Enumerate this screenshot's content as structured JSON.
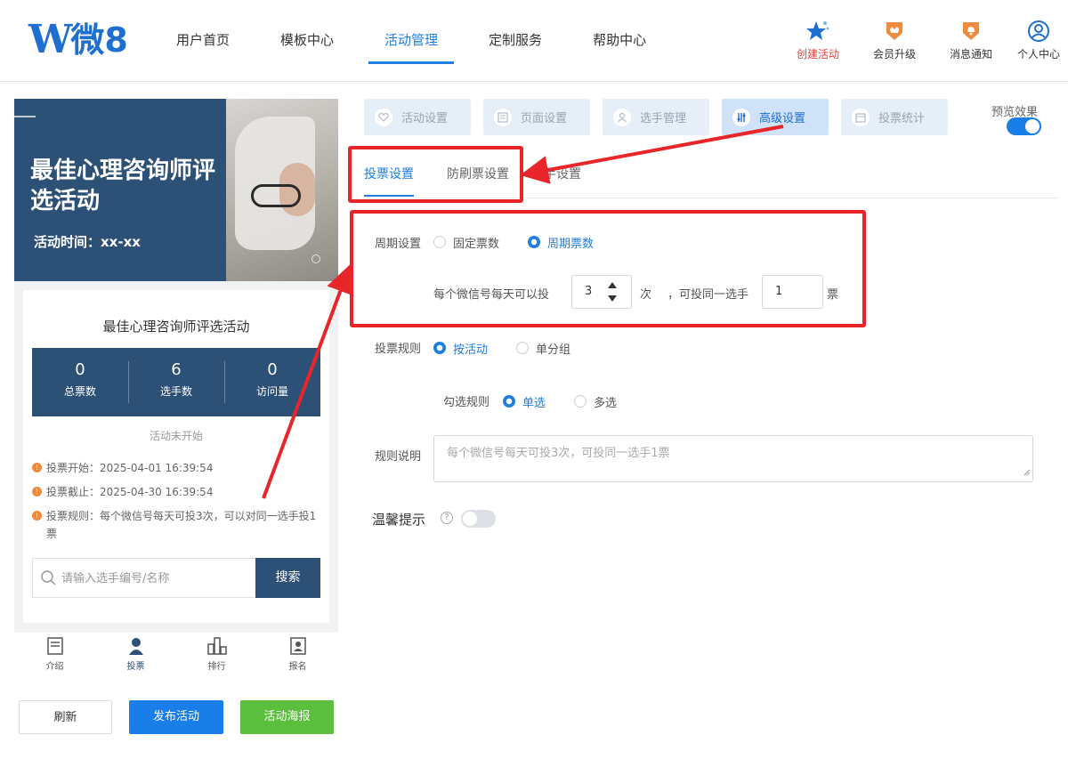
{
  "brand": {
    "logo_text": "微8",
    "logo_letter": "W"
  },
  "nav": {
    "items": [
      "用户首页",
      "模板中心",
      "活动管理",
      "定制服务",
      "帮助中心"
    ],
    "active_index": 2,
    "right": [
      {
        "label": "创建活动",
        "icon": "star-icon"
      },
      {
        "label": "会员升级",
        "icon": "crown-badge-icon"
      },
      {
        "label": "消息通知",
        "icon": "bell-badge-icon"
      },
      {
        "label": "个人中心",
        "icon": "user-circle-icon"
      }
    ]
  },
  "preview": {
    "banner_title": "最佳心理咨询师评选活动",
    "banner_time": "活动时间：xx-xx",
    "card_title": "最佳心理咨询师评选活动",
    "stats": [
      {
        "value": "0",
        "label": "总票数"
      },
      {
        "value": "6",
        "label": "选手数"
      },
      {
        "value": "0",
        "label": "访问量"
      }
    ],
    "status": "活动未开始",
    "info": [
      "投票开始：2025-04-01 16:39:54",
      "投票截止：2025-04-30 16:39:54",
      "投票规则：每个微信号每天可投3次，可以对同一选手投1票"
    ],
    "search": {
      "placeholder": "请输入选手编号/名称",
      "button": "搜索"
    },
    "tabbar": [
      {
        "label": "介绍",
        "icon": "document-icon"
      },
      {
        "label": "投票",
        "icon": "person-icon"
      },
      {
        "label": "排行",
        "icon": "rank-bars-icon"
      },
      {
        "label": "报名",
        "icon": "id-card-icon"
      }
    ]
  },
  "actions": {
    "refresh": "刷新",
    "publish": "发布活动",
    "poster": "活动海报"
  },
  "steps": [
    "活动设置",
    "页面设置",
    "选手管理",
    "高级设置",
    "投票统计"
  ],
  "steps_active_index": 3,
  "preview_toggle": {
    "label": "预览效果",
    "on": true
  },
  "subtabs": {
    "vote": "投票设置",
    "anti": "防刷票设置",
    "hidden_partial": "手设置"
  },
  "form": {
    "period": {
      "label": "周期设置",
      "opt1": "固定票数",
      "opt2": "周期票数",
      "selected": "周期票数"
    },
    "per_day": {
      "prefix": "每个微信号每天可以投",
      "value": "3",
      "unit1": "次",
      "mid": "，可投同一选手",
      "value2": "1",
      "unit2": "票"
    },
    "rule": {
      "label": "投票规则",
      "opt1": "按活动",
      "opt2": "单分组",
      "selected": "按活动"
    },
    "check": {
      "label": "勾选规则",
      "opt1": "单选",
      "opt2": "多选",
      "selected": "单选"
    },
    "desc": {
      "label": "规则说明",
      "placeholder": "每个微信号每天可投3次，可投同一选手1票"
    },
    "tip": {
      "label": "温馨提示",
      "on": false
    }
  },
  "colors": {
    "accent": "#1f7ee0",
    "brand_dark": "#2d5077",
    "annotation_red": "#e8262a",
    "green": "#5bbf3d"
  }
}
